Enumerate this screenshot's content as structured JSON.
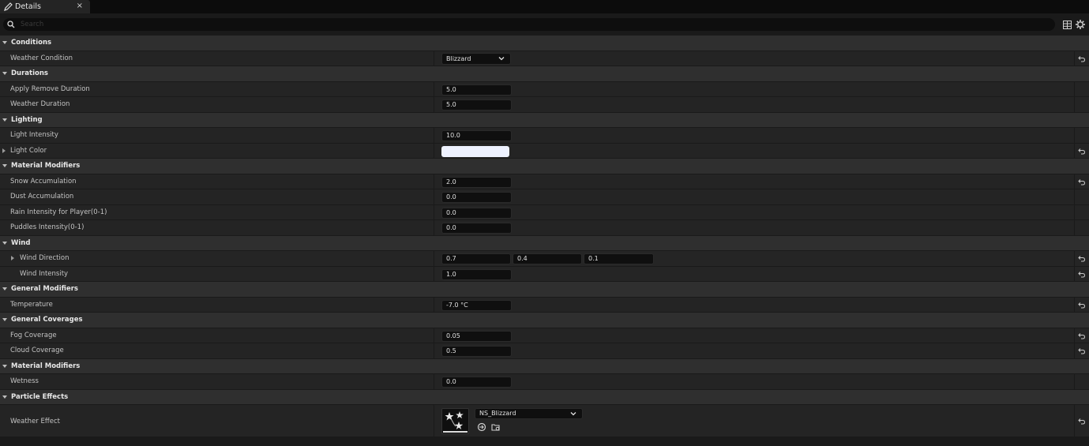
{
  "tab": {
    "title": "Details",
    "close": "×",
    "icon": "pencil-icon"
  },
  "search": {
    "placeholder": "Search"
  },
  "toolbar": {
    "icons": [
      "grid-view-icon",
      "settings-gear-icon"
    ]
  },
  "sections": {
    "conditions": {
      "label": "Conditions",
      "weather_condition": {
        "label": "Weather Condition",
        "value": "Blizzard"
      }
    },
    "durations": {
      "label": "Durations",
      "apply_remove_duration": {
        "label": "Apply Remove Duration",
        "value": "5.0"
      },
      "weather_duration": {
        "label": "Weather Duration",
        "value": "5.0"
      }
    },
    "lighting": {
      "label": "Lighting",
      "light_intensity": {
        "label": "Light Intensity",
        "value": "10.0"
      },
      "light_color": {
        "label": "Light Color",
        "color": "#eef2ff"
      }
    },
    "material_modifiers": {
      "label": "Material Modifiers",
      "snow_accumulation": {
        "label": "Snow Accumulation",
        "value": "2.0"
      },
      "dust_accumulation": {
        "label": "Dust Accumulation",
        "value": "0.0"
      },
      "rain_intensity": {
        "label": "Rain Intensity for Player(0-1)",
        "value": "0.0"
      },
      "puddles_intensity": {
        "label": "Puddles Intensity(0-1)",
        "value": "0.0"
      }
    },
    "wind": {
      "label": "Wind",
      "wind_direction": {
        "label": "Wind Direction",
        "x": "0.7",
        "y": "0.4",
        "z": "0.1"
      },
      "wind_intensity": {
        "label": "Wind Intensity",
        "value": "1.0"
      }
    },
    "general_modifiers": {
      "label": "General Modifiers",
      "temperature": {
        "label": "Temperature",
        "value": "-7.0 °C"
      }
    },
    "general_coverages": {
      "label": "General Coverages",
      "fog_coverage": {
        "label": "Fog Coverage",
        "value": "0.05"
      },
      "cloud_coverage": {
        "label": "Cloud Coverage",
        "value": "0.5"
      }
    },
    "material_modifiers_2": {
      "label": "Material Modifiers",
      "wetness": {
        "label": "Wetness",
        "value": "0.0"
      }
    },
    "particle_effects": {
      "label": "Particle Effects",
      "weather_effect": {
        "label": "Weather Effect",
        "asset": "NS_Blizzard"
      }
    }
  }
}
